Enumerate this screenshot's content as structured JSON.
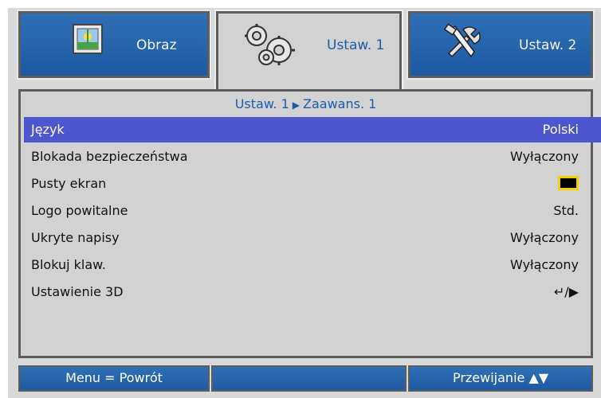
{
  "tabs": [
    {
      "label": "Obraz",
      "icon": "picture-icon"
    },
    {
      "label": "Ustaw. 1",
      "icon": "gears-icon"
    },
    {
      "label": "Ustaw. 2",
      "icon": "tools-icon"
    }
  ],
  "breadcrumb": {
    "part1": "Ustaw. 1",
    "separator": "▶",
    "part2": "Zaawans. 1"
  },
  "menu": [
    {
      "name": "Język",
      "value": "Polski"
    },
    {
      "name": "Blokada bezpieczeństwa",
      "value": "Wyłączony"
    },
    {
      "name": "Pusty ekran",
      "value": ""
    },
    {
      "name": "Logo powitalne",
      "value": "Std."
    },
    {
      "name": "Ukryte napisy",
      "value": "Wyłączony"
    },
    {
      "name": "Blokuj klaw.",
      "value": "Wyłączony"
    },
    {
      "name": "Ustawienie 3D",
      "value": "↵/▶"
    }
  ],
  "footer": {
    "left": "Menu = Powrót",
    "middle": "",
    "right": "Przewijanie ▲▼"
  },
  "colors": {
    "tab_blue": "#2467b0",
    "highlight": "#4b56cf",
    "panel_bg": "#d2d2d2",
    "accent_text": "#1d5ca8",
    "swatch_border": "#f1d100"
  }
}
